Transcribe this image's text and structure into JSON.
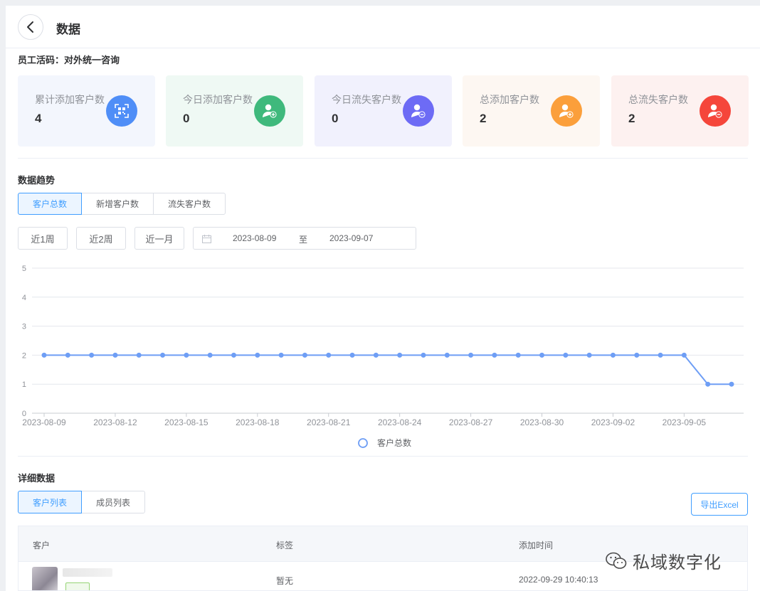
{
  "header": {
    "title": "数据"
  },
  "employee": {
    "label": "员工活码：对外统一咨询"
  },
  "stats": [
    {
      "label": "累计添加客户数",
      "value": "4",
      "icon": "qrcode-icon",
      "bg": "#f3f6fd",
      "color": "#4f8ef7"
    },
    {
      "label": "今日添加客户数",
      "value": "0",
      "icon": "user-add-icon",
      "bg": "#eff9f4",
      "color": "#3fb97c"
    },
    {
      "label": "今日流失客户数",
      "value": "0",
      "icon": "user-remove-icon",
      "bg": "#f1f1fd",
      "color": "#6d6bf5"
    },
    {
      "label": "总添加客户数",
      "value": "2",
      "icon": "user-add-icon",
      "bg": "#fdf7f2",
      "color": "#fb9f3b"
    },
    {
      "label": "总流失客户数",
      "value": "2",
      "icon": "user-remove-icon",
      "bg": "#fdf1f0",
      "color": "#f5463b"
    }
  ],
  "trend": {
    "title": "数据趋势",
    "tabs": [
      "客户总数",
      "新增客户数",
      "流失客户数"
    ],
    "ranges": [
      "近1周",
      "近2周",
      "近一月"
    ],
    "date_start": "2023-08-09",
    "date_sep": "至",
    "date_end": "2023-09-07"
  },
  "chart_data": {
    "type": "line",
    "x": [
      "2023-08-09",
      "2023-08-10",
      "2023-08-11",
      "2023-08-12",
      "2023-08-13",
      "2023-08-14",
      "2023-08-15",
      "2023-08-16",
      "2023-08-17",
      "2023-08-18",
      "2023-08-19",
      "2023-08-20",
      "2023-08-21",
      "2023-08-22",
      "2023-08-23",
      "2023-08-24",
      "2023-08-25",
      "2023-08-26",
      "2023-08-27",
      "2023-08-28",
      "2023-08-29",
      "2023-08-30",
      "2023-08-31",
      "2023-09-01",
      "2023-09-02",
      "2023-09-03",
      "2023-09-04",
      "2023-09-05",
      "2023-09-06",
      "2023-09-07"
    ],
    "series": [
      {
        "name": "客户总数",
        "values": [
          2,
          2,
          2,
          2,
          2,
          2,
          2,
          2,
          2,
          2,
          2,
          2,
          2,
          2,
          2,
          2,
          2,
          2,
          2,
          2,
          2,
          2,
          2,
          2,
          2,
          2,
          2,
          2,
          1,
          1
        ]
      }
    ],
    "x_tick_labels": [
      "2023-08-09",
      "2023-08-12",
      "2023-08-15",
      "2023-08-18",
      "2023-08-21",
      "2023-08-24",
      "2023-08-27",
      "2023-08-30",
      "2023-09-02",
      "2023-09-05"
    ],
    "ylim": [
      0,
      5
    ],
    "yticks": [
      0,
      1,
      2,
      3,
      4,
      5
    ],
    "grid": true,
    "legend": "bottom-center",
    "color": "#6e9ef5"
  },
  "detail": {
    "title": "详细数据",
    "tabs": [
      "客户列表",
      "成员列表"
    ],
    "export_label": "导出Excel",
    "columns": [
      "客户",
      "标签",
      "添加时间"
    ],
    "rows": [
      {
        "tag": "暂无",
        "time": "2022-09-29 10:40:13"
      }
    ]
  },
  "watermark": {
    "text": "私域数字化"
  }
}
